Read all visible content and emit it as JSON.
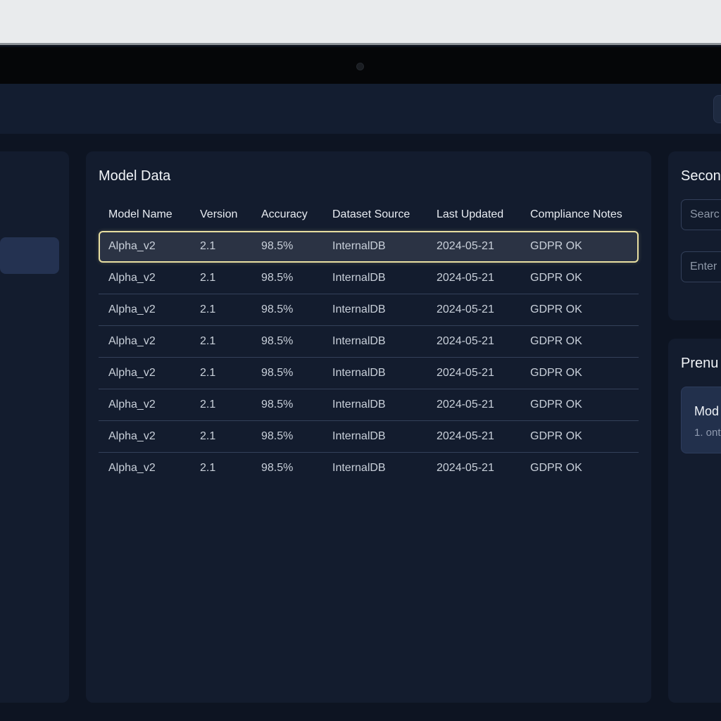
{
  "main": {
    "title": "Model Data",
    "columns": [
      "Model Name",
      "Version",
      "Accuracy",
      "Dataset Source",
      "Last Updated",
      "Compliance Notes"
    ],
    "rows": [
      [
        "Alpha_v2",
        "2.1",
        "98.5%",
        "InternalDB",
        "2024-05-21",
        "GDPR OK"
      ],
      [
        "Alpha_v2",
        "2.1",
        "98.5%",
        "InternalDB",
        "2024-05-21",
        "GDPR OK"
      ],
      [
        "Alpha_v2",
        "2.1",
        "98.5%",
        "InternalDB",
        "2024-05-21",
        "GDPR OK"
      ],
      [
        "Alpha_v2",
        "2.1",
        "98.5%",
        "InternalDB",
        "2024-05-21",
        "GDPR OK"
      ],
      [
        "Alpha_v2",
        "2.1",
        "98.5%",
        "InternalDB",
        "2024-05-21",
        "GDPR OK"
      ],
      [
        "Alpha_v2",
        "2.1",
        "98.5%",
        "InternalDB",
        "2024-05-21",
        "GDPR OK"
      ],
      [
        "Alpha_v2",
        "2.1",
        "98.5%",
        "InternalDB",
        "2024-05-21",
        "GDPR OK"
      ],
      [
        "Alpha_v2",
        "2.1",
        "98.5%",
        "InternalDB",
        "2024-05-21",
        "GDPR OK"
      ]
    ],
    "selected_row": 0
  },
  "right_top": {
    "title": "Secon",
    "search_placeholder": "Searc",
    "enter_placeholder": "Enter"
  },
  "right_bottom": {
    "title": "Prenu",
    "card_title": "Mod",
    "card_sub": "1. ontr"
  },
  "colors": {
    "accent_selection": "#e8dfa1",
    "panel": "#131c2e",
    "background": "#0d1422"
  }
}
